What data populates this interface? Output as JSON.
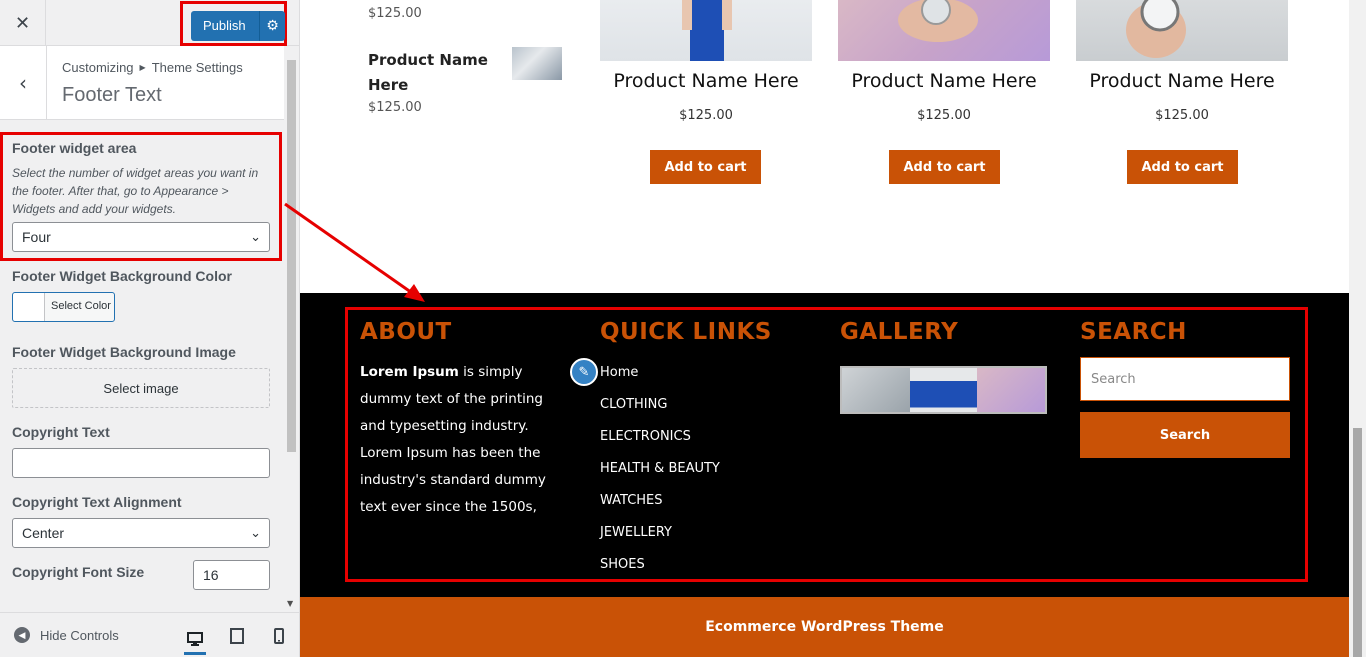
{
  "sidebar": {
    "close_glyph": "✕",
    "publish_label": "Publish",
    "breadcrumb": {
      "root": "Customizing",
      "section": "Theme Settings"
    },
    "section_title": "Footer Text",
    "footer_widget_area": {
      "label": "Footer widget area",
      "description": "Select the number of widget areas you want in the footer. After that, go to Appearance > Widgets and add your widgets.",
      "selected": "Four"
    },
    "bg_color": {
      "label": "Footer Widget Background Color",
      "button": "Select Color"
    },
    "bg_image": {
      "label": "Footer Widget Background Image",
      "button": "Select image"
    },
    "copyright_text": {
      "label": "Copyright Text",
      "value": ""
    },
    "copyright_align": {
      "label": "Copyright Text Alignment",
      "selected": "Center"
    },
    "copyright_font_size": {
      "label": "Copyright Font Size",
      "value": "16"
    },
    "hide_controls": "Hide Controls"
  },
  "preview": {
    "small_product": {
      "price_top": "$125.00",
      "name": "Product Name Here",
      "price": "$125.00"
    },
    "products": [
      {
        "name": "Product Name Here",
        "price": "$125.00",
        "cart": "Add to cart"
      },
      {
        "name": "Product Name Here",
        "price": "$125.00",
        "cart": "Add to cart"
      },
      {
        "name": "Product Name Here",
        "price": "$125.00",
        "cart": "Add to cart"
      }
    ],
    "footer": {
      "about": {
        "heading": "ABOUT",
        "bold": "Lorem Ipsum",
        "text": " is simply dummy text of the printing and typesetting industry. Lorem Ipsum has been the industry's standard dummy text ever since the 1500s,"
      },
      "quick_links": {
        "heading": "QUICK LINKS",
        "items": [
          "Home",
          "CLOTHING",
          "ELECTRONICS",
          "HEALTH & BEAUTY",
          "WATCHES",
          "JEWELLERY",
          "SHOES"
        ]
      },
      "gallery": {
        "heading": "GALLERY"
      },
      "search": {
        "heading": "SEARCH",
        "placeholder": "Search",
        "button": "Search"
      }
    },
    "bottom_bar": "Ecommerce WordPress Theme"
  },
  "colors": {
    "accent": "#c95206",
    "wp_blue": "#2271b1",
    "highlight": "#e60000"
  }
}
